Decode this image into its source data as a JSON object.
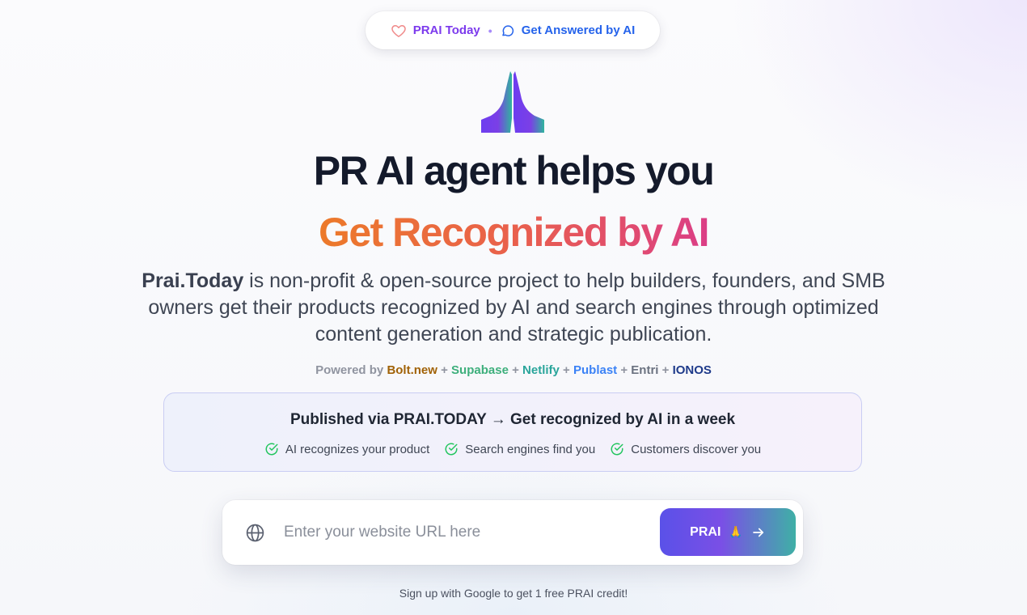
{
  "top_pill": {
    "left_label": "PRAI Today",
    "separator": "•",
    "right_label": "Get Answered by AI"
  },
  "hero": {
    "headline": "PR AI agent helps you",
    "subheadline": "Get Recognized by AI",
    "description_brand": "Prai.Today",
    "description_rest": " is non-profit & open-source project to help builders, founders, and SMB owners get their products recognized by AI and search engines through optimized content generation and strategic publication."
  },
  "powered": {
    "prefix": "Powered by ",
    "plus": " + ",
    "partners": [
      "Bolt.new",
      "Supabase",
      "Netlify",
      "Publast",
      "Entri",
      "IONOS"
    ]
  },
  "card": {
    "title": "Published via PRAI.TODAY → Get recognized by AI in a week",
    "benefits": [
      "AI recognizes your product",
      "Search engines find you",
      "Customers discover you"
    ]
  },
  "search": {
    "placeholder": "Enter your website URL here",
    "value": "",
    "button_label": "PRAI",
    "button_emoji": "🙏"
  },
  "signup_text": "Sign up with Google to get 1 free PRAI credit!",
  "colors": {
    "brand_purple": "#7c3aed",
    "brand_blue": "#2563eb",
    "gradient_orange": "#ec7a2a",
    "gradient_pink": "#db3e86",
    "check_green": "#22c55e"
  },
  "icons": {
    "pill_left": "heart-icon",
    "pill_right": "chat-bubble-icon",
    "hero": "praying-hands-icon",
    "benefit": "check-circle-icon",
    "input": "globe-icon",
    "button": "arrow-right-icon"
  }
}
